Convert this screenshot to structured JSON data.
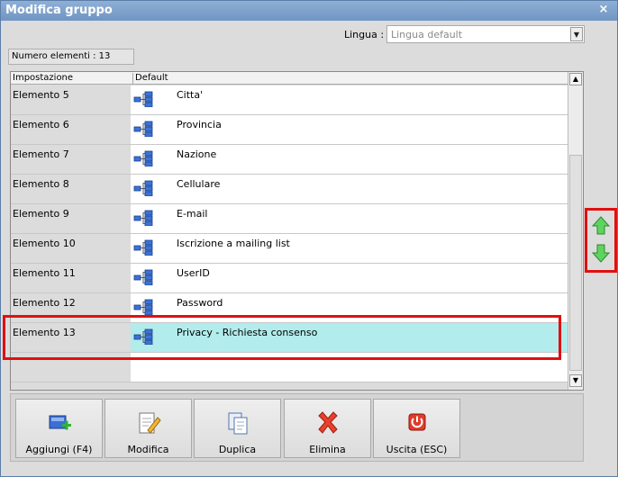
{
  "window": {
    "title": "Modifica gruppo",
    "close_glyph": "×"
  },
  "language": {
    "label": "Lingua :",
    "value": "Lingua default"
  },
  "count_label": "Numero elementi : 13",
  "columns": [
    "Impostazione",
    "Default"
  ],
  "rows": [
    {
      "setting": "Elemento 5",
      "default": "Citta'"
    },
    {
      "setting": "Elemento 6",
      "default": "Provincia"
    },
    {
      "setting": "Elemento 7",
      "default": "Nazione"
    },
    {
      "setting": "Elemento 8",
      "default": "Cellulare"
    },
    {
      "setting": "Elemento 9",
      "default": "E-mail"
    },
    {
      "setting": "Elemento 10",
      "default": "Iscrizione a mailing list"
    },
    {
      "setting": "Elemento 11",
      "default": "UserID"
    },
    {
      "setting": "Elemento 12",
      "default": "Password"
    },
    {
      "setting": "Elemento 13",
      "default": "Privacy - Richiesta consenso"
    }
  ],
  "selected_row": "Elemento 13",
  "toolbar": {
    "add": "Aggiungi (F4)",
    "edit": "Modifica",
    "duplicate": "Duplica",
    "delete": "Elimina",
    "exit": "Uscita (ESC)"
  },
  "colors": {
    "selected_row": "#b2ecec",
    "highlight": "#e01010",
    "arrow_green": "#3fbf3f"
  },
  "icons": {
    "row_icon": "tree-node-icon",
    "move_up": "arrow-up-icon",
    "move_down": "arrow-down-icon"
  }
}
